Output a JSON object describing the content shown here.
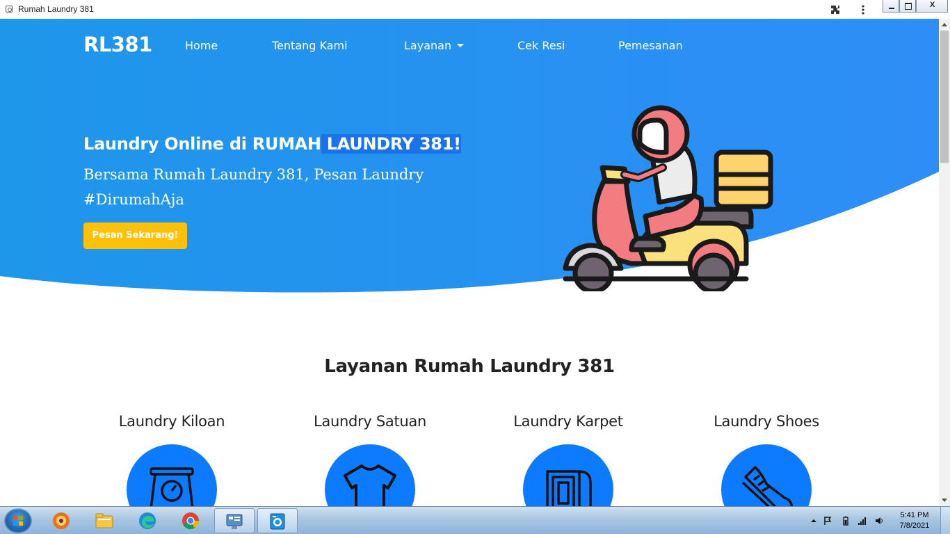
{
  "window": {
    "title": "Rumah Laundry 381"
  },
  "navbar": {
    "brand": "RL381",
    "links": [
      {
        "label": "Home"
      },
      {
        "label": "Tentang Kami"
      },
      {
        "label": "Layanan"
      },
      {
        "label": "Cek Resi"
      },
      {
        "label": "Pemesanan"
      }
    ]
  },
  "hero": {
    "title_start": "Laundry Online di RUMAH",
    "title_highlight": " LAUNDRY 381!",
    "subtitle": "Bersama Rumah Laundry 381, Pesan Laundry #DirumahAja",
    "cta_label": "Pesan Sekarang!",
    "illustration": "delivery-scooter-illustration"
  },
  "services": {
    "title": "Layanan Rumah Laundry 381",
    "items": [
      {
        "label": "Laundry Kiloan",
        "icon": "weighing-scale-icon"
      },
      {
        "label": "Laundry Satuan",
        "icon": "tshirt-icon"
      },
      {
        "label": "Laundry Karpet",
        "icon": "carpet-icon"
      },
      {
        "label": "Laundry Shoes",
        "icon": "sneaker-icon"
      }
    ]
  },
  "taskbar": {
    "apps": [
      {
        "name": "browser-app-icon"
      },
      {
        "name": "file-explorer-icon"
      },
      {
        "name": "edge-icon"
      },
      {
        "name": "chrome-icon"
      },
      {
        "name": "control-panel-icon"
      },
      {
        "name": "laundry-app-icon"
      }
    ],
    "time": "5:41 PM",
    "date": "7/8/2021"
  },
  "colors": {
    "hero_start": "#1e96ea",
    "hero_end": "#2e8ef7",
    "cta": "#ffc107",
    "service_circle": "#0d7bff"
  }
}
